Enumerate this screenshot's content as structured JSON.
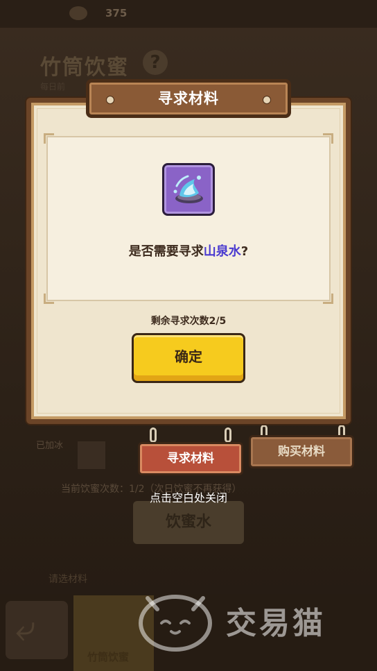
{
  "background": {
    "currency_count": "375",
    "title": "竹筒饮蜜",
    "help_symbol": "?",
    "subtitle": "每日前",
    "ice_label": "已加冰",
    "usage_note": "当前饮蜜次数：1/2（次日饮蜜不再获得）",
    "drink_button": "饮蜜水",
    "section_label": "请选材料",
    "bottom_tab": "竹筒饮蜜"
  },
  "modal": {
    "title": "寻求材料",
    "question_prefix": "是否需要寻求",
    "item_name": "山泉水",
    "question_suffix": "?",
    "remaining": "剩余寻求次数2/5",
    "confirm_label": "确定"
  },
  "tabs": {
    "seek_label": "寻求材料",
    "buy_label": "购买材料"
  },
  "close_hint": "点击空白处关闭",
  "watermark": "交易猫",
  "colors": {
    "accent_yellow": "#f6cb1e",
    "item_name": "#4a3ad0",
    "panel": "#efe5ce",
    "frame": "#6b4427"
  },
  "icons": {
    "item": "spring-water-icon",
    "back": "back-arrow-icon",
    "watermark": "cat-logo-icon"
  }
}
